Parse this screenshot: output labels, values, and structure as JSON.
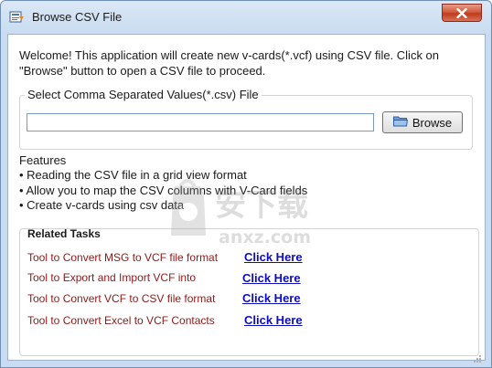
{
  "window": {
    "title": "Browse CSV File",
    "close_label": "✕"
  },
  "welcome_text": "Welcome! This application will create new v-cards(*.vcf) using CSV file. Click on \"Browse\" button to open a CSV file to proceed.",
  "file_section": {
    "label": "Select Comma Separated Values(*.csv)  File",
    "input_value": "",
    "browse_label": "Browse"
  },
  "features": {
    "title": "Features",
    "items": [
      "Reading the CSV file in a grid view format",
      "Allow you to map the CSV columns with V-Card fields",
      "Create v-cards using csv data"
    ]
  },
  "related_tasks": {
    "title": "Related Tasks",
    "tasks": [
      {
        "label": "Tool to Convert MSG to VCF file format",
        "link": "Click Here"
      },
      {
        "label": "Tool to Export and Import VCF into",
        "link": "Click Here"
      },
      {
        "label": "Tool to Convert VCF to CSV file format",
        "link": "Click Here"
      },
      {
        "label": "Tool to Convert Excel to VCF Contacts",
        "link": "Click Here"
      }
    ]
  },
  "watermark": {
    "text_cn": "安下载",
    "text_en": "anxz.com"
  },
  "icons": {
    "app": "app-icon",
    "close": "close-icon",
    "browse": "folder-icon"
  },
  "colors": {
    "task_label": "#8b1a1a",
    "link": "#0d0dbd",
    "close_button": "#c9472b"
  }
}
